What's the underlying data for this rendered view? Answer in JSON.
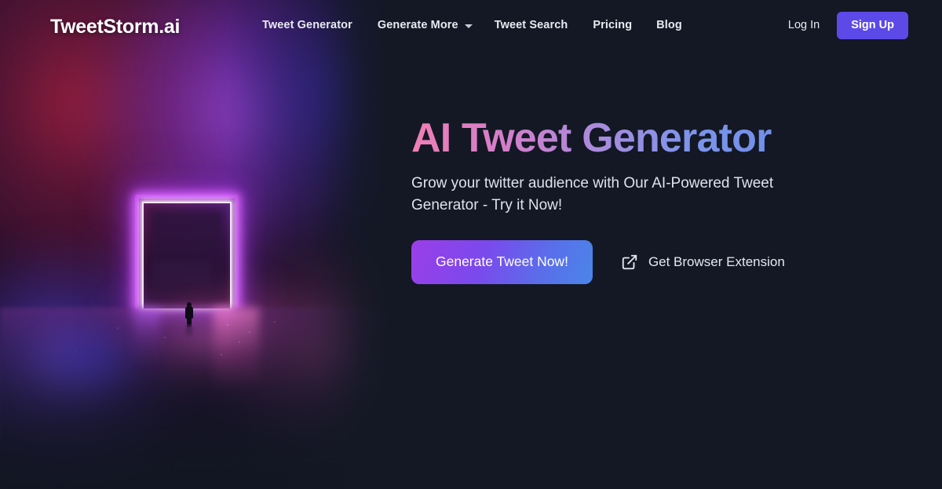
{
  "brand": {
    "logo_text": "TweetStorm.ai"
  },
  "nav": {
    "links": [
      {
        "label": "Tweet Generator",
        "icon": null
      },
      {
        "label": "Generate More",
        "icon": "chevron-down-icon"
      },
      {
        "label": "Tweet Search",
        "icon": null
      },
      {
        "label": "Pricing",
        "icon": null
      },
      {
        "label": "Blog",
        "icon": null
      }
    ],
    "login_label": "Log In",
    "signup_label": "Sign Up"
  },
  "hero": {
    "title": "AI Tweet Generator",
    "subtitle": "Grow your twitter audience with Our AI-Powered Tweet Generator - Try it Now!",
    "cta_label": "Generate Tweet Now!",
    "extension_label": "Get Browser Extension",
    "extension_icon": "external-link-icon"
  },
  "colors": {
    "page_background": "#131824",
    "signup_button": "#5b4ae8",
    "cta_gradient_start": "#9b3ee8",
    "cta_gradient_end": "#4a86e8",
    "title_gradient_start": "#ef7fb6",
    "title_gradient_end": "#6b8ce8",
    "nav_text": "#e9eaf2",
    "subtitle_text": "#dfe2ec",
    "neon_portal": "#c44ef0"
  },
  "artwork": {
    "description": "Neon purple portal archway with silhouetted figure walking through pink and blue fog over wet reflective ground"
  }
}
